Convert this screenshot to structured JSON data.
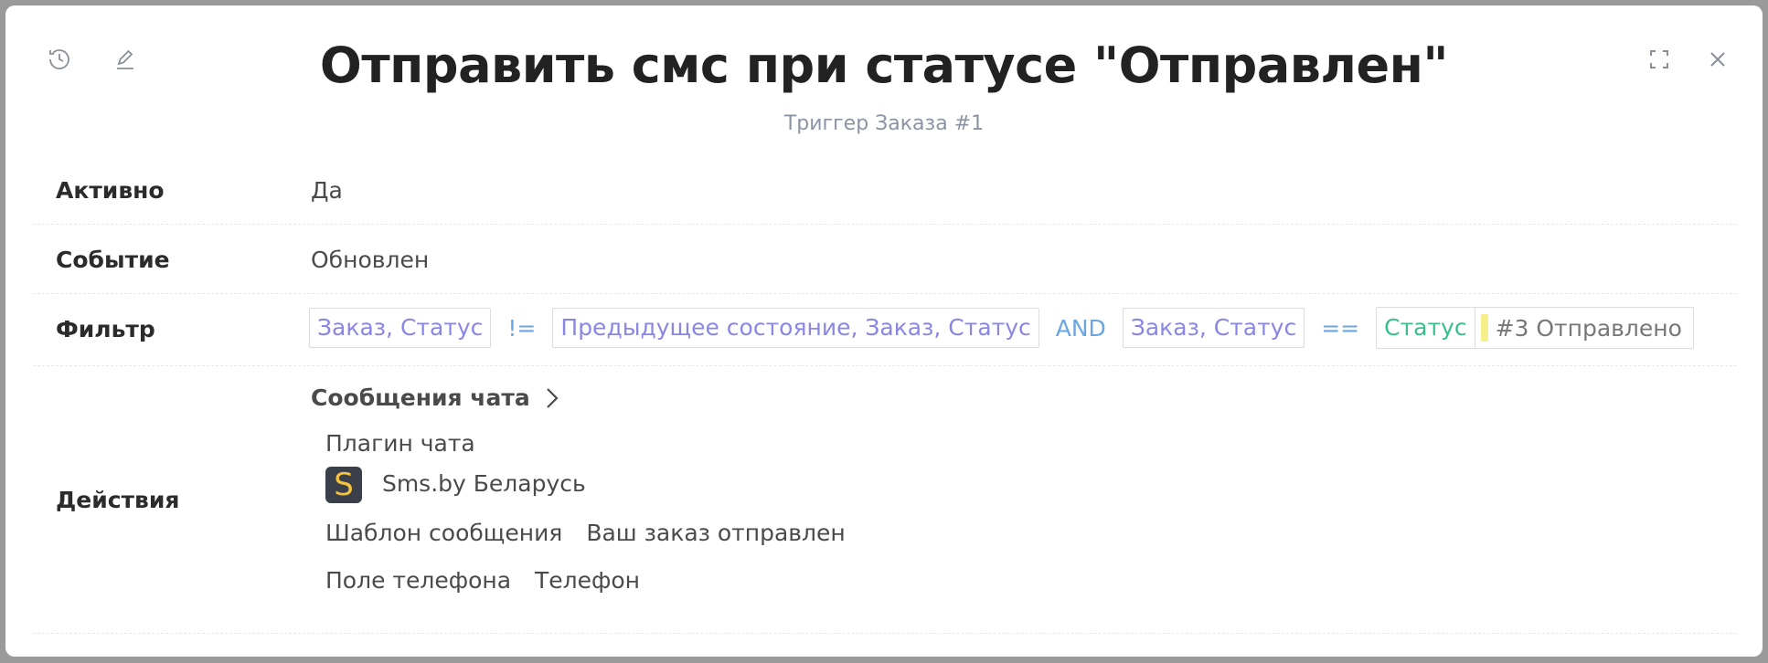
{
  "header": {
    "title": "Отправить смс при статусе \"Отправлен\"",
    "subtitle": "Триггер Заказа #1",
    "icons": [
      "history-icon",
      "edit-icon",
      "fullscreen-icon",
      "close-icon"
    ]
  },
  "fields": {
    "active": {
      "label": "Активно",
      "value": "Да"
    },
    "event": {
      "label": "Событие",
      "value": "Обновлен"
    },
    "filter": {
      "label": "Фильтр",
      "chip1": "Заказ, Статус",
      "op1": "!=",
      "chip2": "Предыдущее состояние, Заказ, Статус",
      "op2": "AND",
      "chip3": "Заказ, Статус",
      "op3": "==",
      "status_key": "Статус",
      "status_value": "#3 Отправлено"
    },
    "actions": {
      "label": "Действия",
      "section_title": "Сообщения чата",
      "plugin_label": "Плагин чата",
      "plugin_logo_letter": "S",
      "plugin_name": "Sms.by Беларусь",
      "template_label": "Шаблон сообщения",
      "template_value": "Ваш заказ отправлен",
      "phone_label": "Поле телефона",
      "phone_value": "Телефон"
    }
  },
  "colors": {
    "chip_text": "#8a86e6",
    "operator": "#6aa6df",
    "status_key": "#3bbf8a",
    "status_marker": "#f5f08a"
  }
}
